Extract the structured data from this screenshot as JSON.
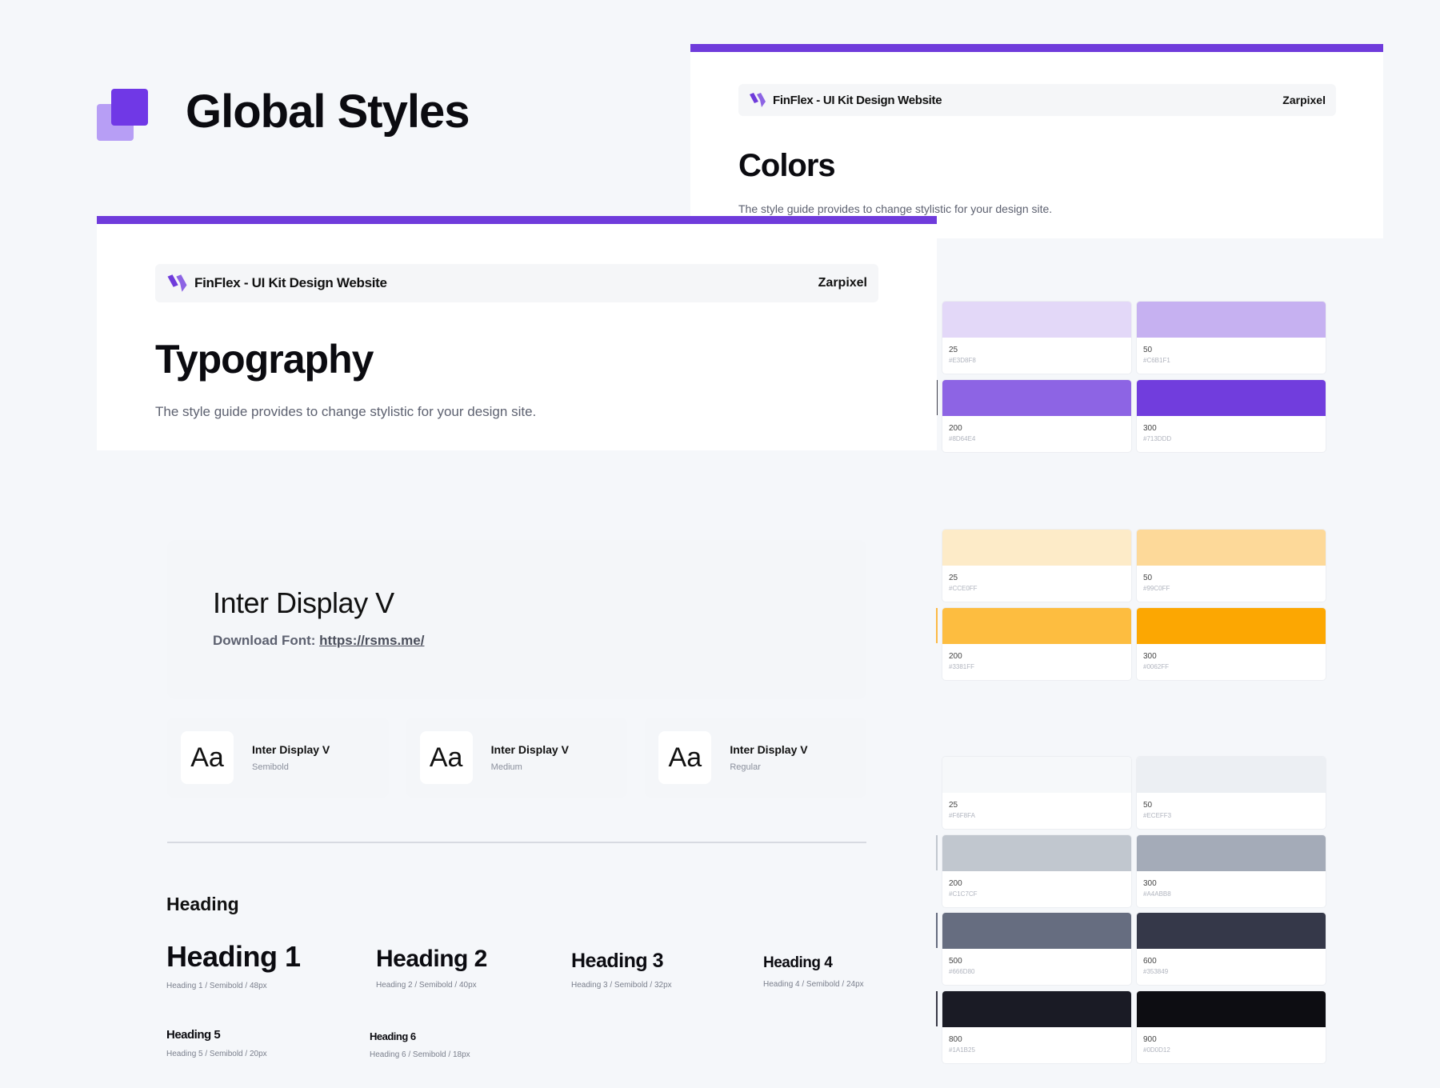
{
  "page_title": "Global Styles",
  "colors_card": {
    "brand": "FinFlex - UI Kit Design Website",
    "maker": "Zarpixel",
    "title": "Colors",
    "subtitle": "The style guide provides to change stylistic for your design site."
  },
  "typography_card": {
    "brand": "FinFlex - UI Kit Design Website",
    "maker": "Zarpixel",
    "title": "Typography",
    "subtitle": "The style guide provides to change stylistic for your design site."
  },
  "font_panel": {
    "name": "Inter Display V",
    "download_label": "Download Font:",
    "download_link": "https://rsms.me/"
  },
  "weights": [
    {
      "glyph": "Aa",
      "name": "Inter Display V",
      "weight": "Semibold"
    },
    {
      "glyph": "Aa",
      "name": "Inter Display V",
      "weight": "Medium"
    },
    {
      "glyph": "Aa",
      "name": "Inter Display V",
      "weight": "Regular"
    }
  ],
  "headings": {
    "section_label": "Heading",
    "items": [
      {
        "title": "Heading 1",
        "meta": "Heading 1 / Semibold / 48px"
      },
      {
        "title": "Heading 2",
        "meta": "Heading 2 / Semibold / 40px"
      },
      {
        "title": "Heading 3",
        "meta": "Heading 3 / Semibold / 32px"
      },
      {
        "title": "Heading 4",
        "meta": "Heading 4 / Semibold / 24px"
      },
      {
        "title": "Heading 5",
        "meta": "Heading 5 / Semibold / 20px"
      },
      {
        "title": "Heading 6",
        "meta": "Heading 6 / Semibold / 18px"
      }
    ]
  },
  "palettes": {
    "purple": [
      {
        "label": "25",
        "hex": "#E3D8F8",
        "color": "#e3d8f8"
      },
      {
        "label": "50",
        "hex": "#C6B1F1",
        "color": "#c6b1f1"
      },
      {
        "label": "200",
        "hex": "#8D64E4",
        "color": "#8d64e4"
      },
      {
        "label": "300",
        "hex": "#713DDD",
        "color": "#713ddd"
      }
    ],
    "orange": [
      {
        "label": "25",
        "hex": "#CCE0FF",
        "color": "#fdebc8"
      },
      {
        "label": "50",
        "hex": "#99C0FF",
        "color": "#fdd999"
      },
      {
        "label": "200",
        "hex": "#3381FF",
        "color": "#fdbd40"
      },
      {
        "label": "300",
        "hex": "#0062FF",
        "color": "#fca702"
      }
    ],
    "gray": [
      {
        "label": "25",
        "hex": "#F6F8FA",
        "color": "#f6f8fa"
      },
      {
        "label": "50",
        "hex": "#ECEFF3",
        "color": "#eceff3"
      },
      {
        "label": "200",
        "hex": "#C1C7CF",
        "color": "#c1c7cf"
      },
      {
        "label": "300",
        "hex": "#A4ABB8",
        "color": "#a4abb8"
      },
      {
        "label": "500",
        "hex": "#666D80",
        "color": "#666d80"
      },
      {
        "label": "600",
        "hex": "#353849",
        "color": "#353849"
      },
      {
        "label": "800",
        "hex": "#1A1B25",
        "color": "#1a1b25"
      },
      {
        "label": "900",
        "hex": "#0D0D12",
        "color": "#0d0d12"
      }
    ]
  },
  "colors": {
    "accent": "#6f3bdb",
    "accent_light": "#b79ef5"
  }
}
